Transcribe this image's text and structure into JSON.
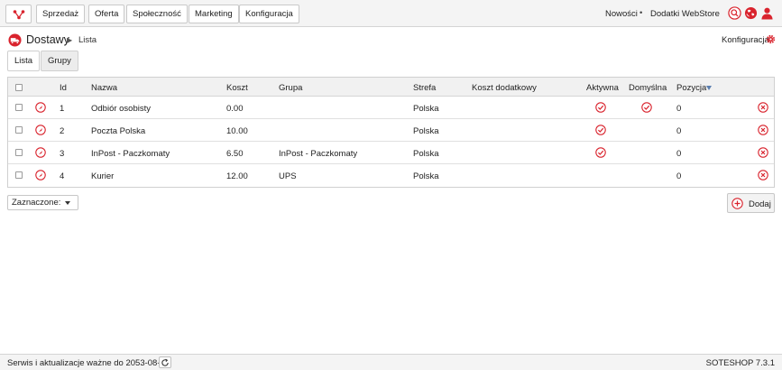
{
  "nav": {
    "items": [
      "Sprzedaż",
      "Oferta",
      "Społeczność",
      "Marketing",
      "Konfiguracja"
    ],
    "right_links": [
      "Nowości",
      "Dodatki WebStore"
    ],
    "separator": "•"
  },
  "breadcrumb": {
    "title": "Dostawy",
    "arrow": "▶",
    "current": "Lista"
  },
  "config_link": "Konfiguracja",
  "tabs": [
    "Lista",
    "Grupy"
  ],
  "table": {
    "columns": {
      "id": "Id",
      "nazwa": "Nazwa",
      "koszt": "Koszt",
      "grupa": "Grupa",
      "strefa": "Strefa",
      "koszt_dodatkowy": "Koszt dodatkowy",
      "aktywna": "Aktywna",
      "domyslna": "Domyślna",
      "pozycja": "Pozycja"
    },
    "rows": [
      {
        "id": "1",
        "nazwa": "Odbiór osobisty",
        "koszt": "0.00",
        "grupa": "",
        "strefa": "Polska",
        "koszt_dodatkowy": "",
        "aktywna": true,
        "domyslna": true,
        "pozycja": "0"
      },
      {
        "id": "2",
        "nazwa": "Poczta Polska",
        "koszt": "10.00",
        "grupa": "",
        "strefa": "Polska",
        "koszt_dodatkowy": "",
        "aktywna": true,
        "domyslna": false,
        "pozycja": "0"
      },
      {
        "id": "3",
        "nazwa": "InPost - Paczkomaty",
        "koszt": "6.50",
        "grupa": "InPost - Paczkomaty",
        "strefa": "Polska",
        "koszt_dodatkowy": "",
        "aktywna": true,
        "domyslna": false,
        "pozycja": "0"
      },
      {
        "id": "4",
        "nazwa": "Kurier",
        "koszt": "12.00",
        "grupa": "UPS",
        "strefa": "Polska",
        "koszt_dodatkowy": "",
        "aktywna": false,
        "domyslna": false,
        "pozycja": "0"
      }
    ]
  },
  "bulk_select": {
    "value": "Zaznaczone:"
  },
  "add_button": "Dodaj",
  "footer": {
    "service_text": "Serwis i aktualizacje ważne do 2053-08-26",
    "version": "SOTESHOP 7.3.1"
  },
  "colors": {
    "accent_red": "#d9232d",
    "sort_blue": "#5b7fb0"
  },
  "icons": {
    "edit": "compass-edit-icon",
    "active": "check-circle-icon",
    "delete": "x-circle-icon"
  }
}
